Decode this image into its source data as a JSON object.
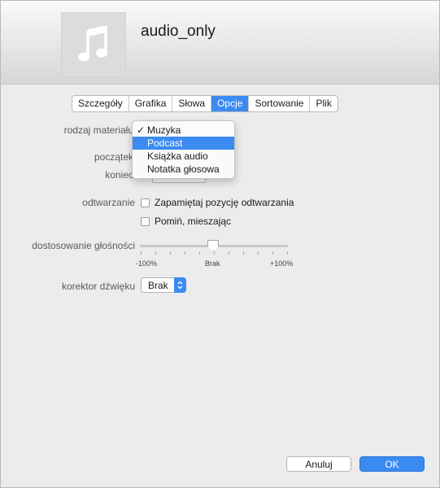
{
  "header": {
    "title": "audio_only",
    "artwork_icon": "music-note-icon"
  },
  "tabs": [
    {
      "label": "Szczegóły",
      "active": false
    },
    {
      "label": "Grafika",
      "active": false
    },
    {
      "label": "Słowa",
      "active": false
    },
    {
      "label": "Opcje",
      "active": true
    },
    {
      "label": "Sortowanie",
      "active": false
    },
    {
      "label": "Plik",
      "active": false
    }
  ],
  "labels": {
    "media_kind": "rodzaj materiału",
    "start": "początek",
    "stop": "koniec",
    "playback": "odtwarzanie",
    "volume": "dostosowanie głośności",
    "equalizer": "korektor dźwięku"
  },
  "media_kind_menu": {
    "items": [
      "Muzyka",
      "Podcast",
      "Książka audio",
      "Notatka głosowa"
    ],
    "checked": "Muzyka",
    "highlighted": "Podcast"
  },
  "playback": {
    "remember_position": {
      "label": "Zapamiętaj pozycję odtwarzania",
      "checked": false
    },
    "skip_shuffle": {
      "label": "Pomiń, mieszając",
      "checked": false
    }
  },
  "volume_slider": {
    "min_label": "-100%",
    "mid_label": "Brak",
    "max_label": "+100%",
    "value_percent": 0
  },
  "equalizer": {
    "selected": "Brak"
  },
  "footer": {
    "cancel_label": "Anuluj",
    "ok_label": "OK"
  },
  "colors": {
    "accent": "#3b8bf1",
    "background": "#ececec"
  }
}
